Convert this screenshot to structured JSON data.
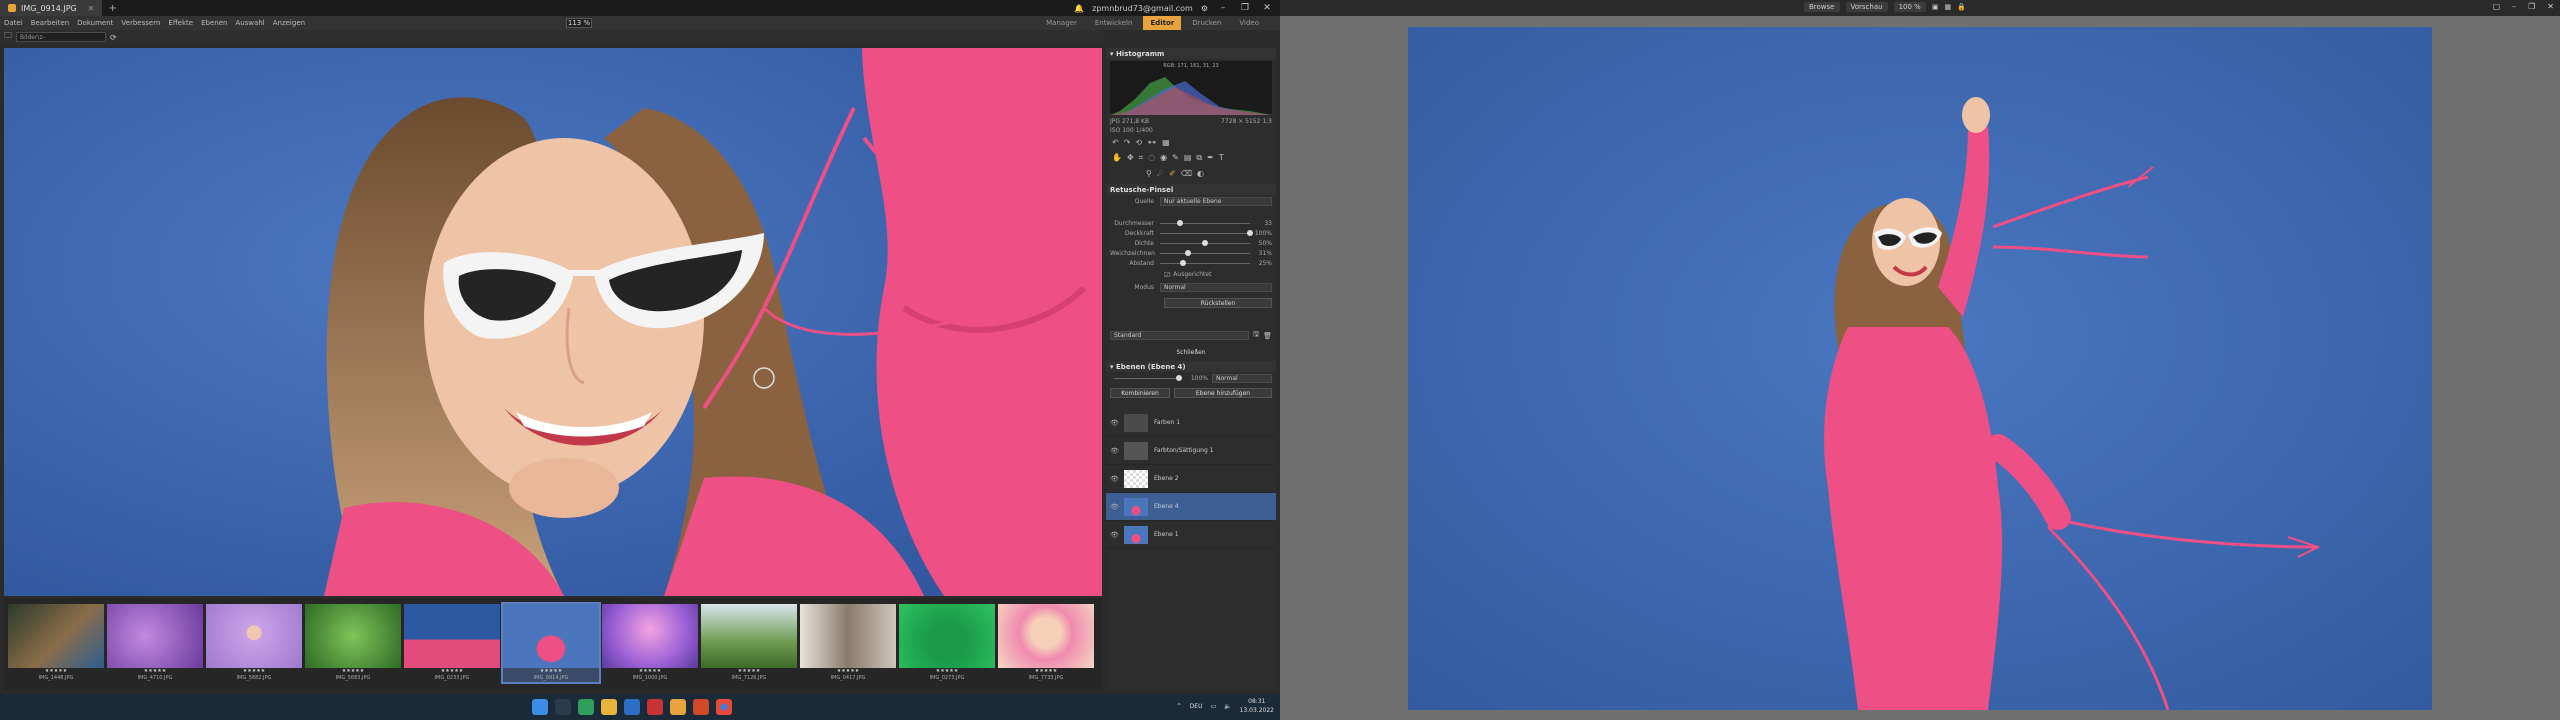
{
  "left": {
    "tab": {
      "title": "IMG_0914.JPG"
    },
    "account": {
      "email": "zpmnbrud73@gmail.com"
    },
    "menu": [
      "Datei",
      "Bearbeiten",
      "Dokument",
      "Verbessern",
      "Effekte",
      "Ebenen",
      "Auswahl",
      "Anzeigen"
    ],
    "zoom": "113 %",
    "modes": [
      {
        "label": "Manager",
        "active": false
      },
      {
        "label": "Entwickeln",
        "active": false
      },
      {
        "label": "Editor",
        "active": true
      },
      {
        "label": "Drucken",
        "active": false
      },
      {
        "label": "Video",
        "active": false
      }
    ],
    "path": "Bilder\\z-Testbilder\\SEO\\Overall",
    "panel": {
      "histogram": {
        "title": "Histogramm",
        "readout": "RGB: 171, 161, 31, 23"
      },
      "info": {
        "format": "JPG  271,8 KB",
        "dimensions": "7728 × 5152 1:3",
        "exif": "ISO 100  1/400"
      },
      "retouch": {
        "title": "Retusche-Pinsel",
        "source_label": "Quelle",
        "source_value": "Nur aktuelle Ebene",
        "params": [
          {
            "label": "Durchmesser",
            "value": "33",
            "level": 0.22
          },
          {
            "label": "Deckkraft",
            "value": "100%",
            "level": 1.0
          },
          {
            "label": "Dichte",
            "value": "50%",
            "level": 0.5
          },
          {
            "label": "Weichzeichnen",
            "value": "31%",
            "level": 0.31
          },
          {
            "label": "Abstand",
            "value": "25%",
            "level": 0.25
          }
        ],
        "sample_label": "Ausgerichtet",
        "mode_label": "Modus",
        "mode_value": "Normal",
        "reset_button": "Rückstellen"
      },
      "presets": {
        "value": "Standard"
      },
      "close_button": "Schließen",
      "layers": {
        "title": "Ebenen (Ebene 4)",
        "opacity": "100%",
        "blend": "Normal",
        "combine_button": "Kombinieren",
        "add_button": "Ebene hinzufügen",
        "items": [
          {
            "name": "Farben 1",
            "selected": false
          },
          {
            "name": "Farbton/Sättigung 1",
            "selected": false
          },
          {
            "name": "Ebene 2",
            "selected": false
          },
          {
            "name": "Ebene 4",
            "selected": true
          },
          {
            "name": "Ebene 1",
            "selected": false
          }
        ]
      }
    },
    "filmstrip": [
      {
        "name": "IMG_1448.JPG"
      },
      {
        "name": "IMG_4710.JPG"
      },
      {
        "name": "IMG_5882.JPG"
      },
      {
        "name": "IMG_5683.JPG"
      },
      {
        "name": "IMG_0233.JPG"
      },
      {
        "name": "IMG_0914.JPG"
      },
      {
        "name": "IMG_1000.JPG"
      },
      {
        "name": "IMG_7126.JPG"
      },
      {
        "name": "IMG_0417.JPG"
      },
      {
        "name": "IMG_0273.JPG"
      },
      {
        "name": "IMG_7733.JPG"
      }
    ],
    "taskbar": {
      "lang": "DEU",
      "time": "08:31",
      "date": "13.03.2022"
    }
  },
  "right": {
    "toolbar": {
      "browse": "Browse",
      "compare": "Vorschau",
      "zoom": "100 %"
    }
  },
  "colors": {
    "accent": "#e8a33c",
    "selection": "#3e5f94",
    "wall": "#3d67b0",
    "outfit": "#ee4f84"
  }
}
